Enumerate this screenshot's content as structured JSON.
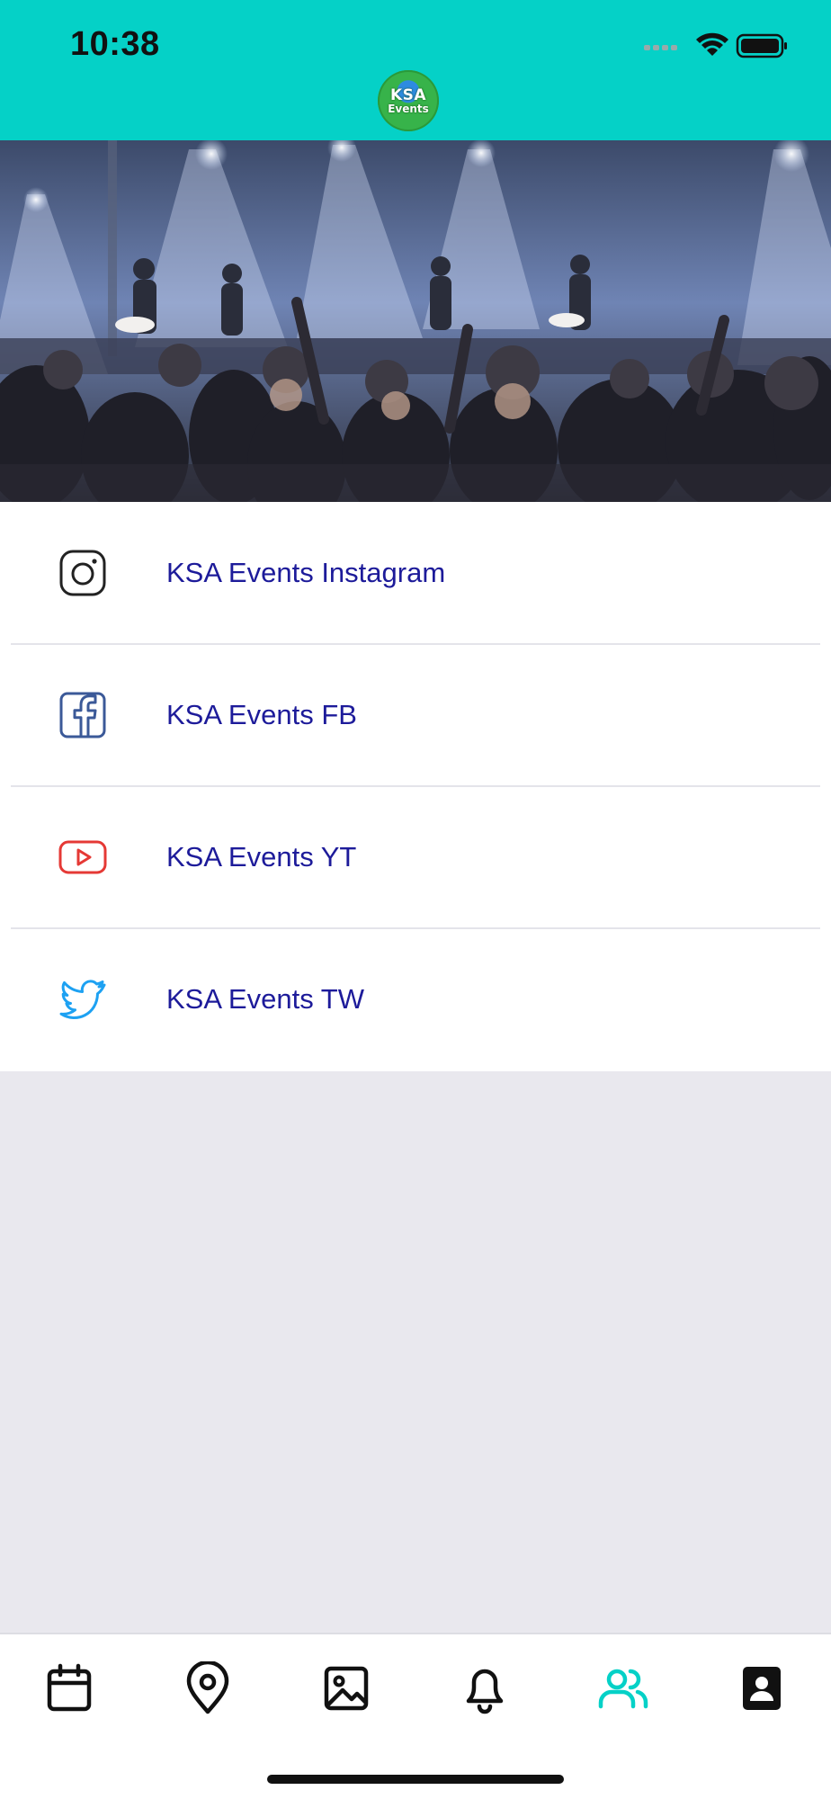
{
  "status_bar": {
    "time": "10:38"
  },
  "header": {
    "logo_line1": "KSA",
    "logo_line2": "Events",
    "background": "#05d1c7"
  },
  "hero": {
    "image_alt": "concert crowd"
  },
  "links": [
    {
      "label": "KSA Events Instagram",
      "icon": "instagram-icon",
      "color": "#222222"
    },
    {
      "label": "KSA Events FB",
      "icon": "facebook-icon",
      "color": "#3b5998"
    },
    {
      "label": "KSA Events YT",
      "icon": "youtube-icon",
      "color": "#e53935"
    },
    {
      "label": "KSA Events TW",
      "icon": "twitter-icon",
      "color": "#1da1f2"
    }
  ],
  "tabbar": {
    "active_color": "#05d1c7",
    "tabs": [
      {
        "icon": "calendar-icon",
        "active": false
      },
      {
        "icon": "location-pin-icon",
        "active": false
      },
      {
        "icon": "image-icon",
        "active": false
      },
      {
        "icon": "bell-icon",
        "active": false
      },
      {
        "icon": "users-icon",
        "active": true
      },
      {
        "icon": "contact-card-icon",
        "active": false
      }
    ]
  }
}
